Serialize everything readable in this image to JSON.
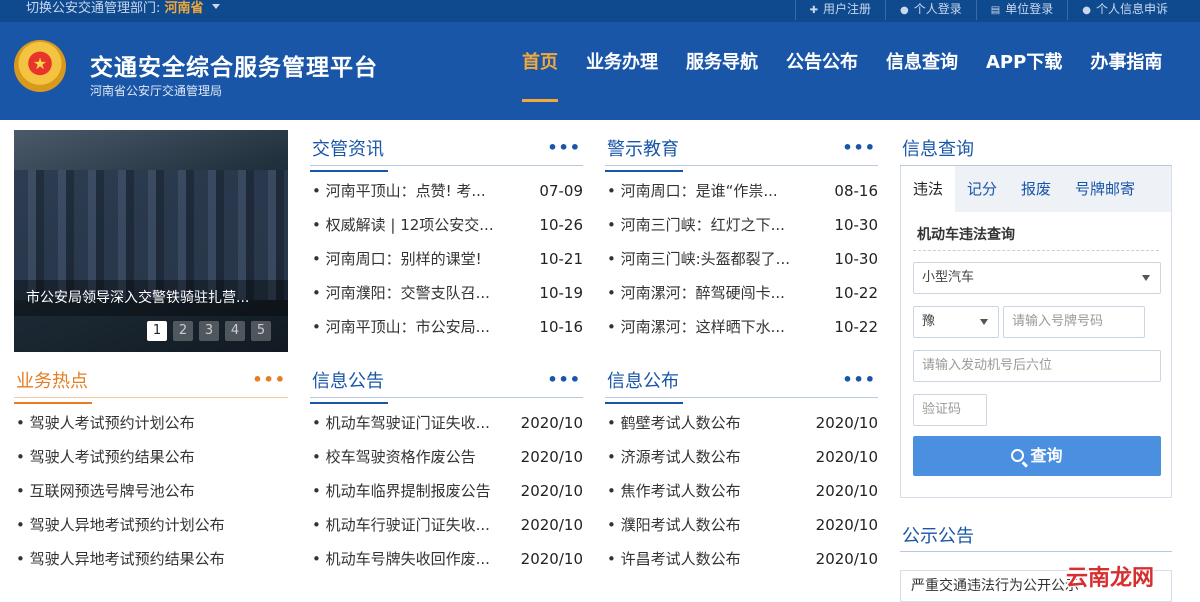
{
  "topbar": {
    "switch_label": "切换公安交通管理部门:",
    "province": "河南省",
    "links": [
      "用户注册",
      "个人登录",
      "单位登录",
      "个人信息申诉"
    ]
  },
  "header": {
    "title": "交通安全综合服务管理平台",
    "subtitle": "河南省公安厅交通管理局",
    "nav": [
      "首页",
      "业务办理",
      "服务导航",
      "公告公布",
      "信息查询",
      "APP下载",
      "办事指南"
    ]
  },
  "carousel": {
    "caption": "市公安局领导深入交警铁骑驻扎营...",
    "dots": [
      "1",
      "2",
      "3",
      "4",
      "5"
    ]
  },
  "panels": {
    "news": {
      "title": "交管资讯",
      "more": "•••",
      "items": [
        {
          "t": "• 河南平顶山：点赞! 考...",
          "d": "07-09"
        },
        {
          "t": "• 权威解读 | 12项公安交...",
          "d": "10-26"
        },
        {
          "t": "• 河南周口：别样的课堂!",
          "d": "10-21"
        },
        {
          "t": "• 河南濮阳：交警支队召...",
          "d": "10-19"
        },
        {
          "t": "• 河南平顶山：市公安局...",
          "d": "10-16"
        }
      ]
    },
    "warning": {
      "title": "警示教育",
      "more": "•••",
      "items": [
        {
          "t": "• 河南周口：是谁“作祟...",
          "d": "08-16"
        },
        {
          "t": "• 河南三门峡：红灯之下...",
          "d": "10-30"
        },
        {
          "t": "• 河南三门峡:头盔都裂了...",
          "d": "10-30"
        },
        {
          "t": "• 河南漯河：醉驾硬闯卡...",
          "d": "10-22"
        },
        {
          "t": "• 河南漯河：这样晒下水...",
          "d": "10-22"
        }
      ]
    },
    "hot": {
      "title": "业务热点",
      "more": "•••",
      "items": [
        {
          "t": "• 驾驶人考试预约计划公布"
        },
        {
          "t": "• 驾驶人考试预约结果公布"
        },
        {
          "t": "• 互联网预选号牌号池公布"
        },
        {
          "t": "• 驾驶人异地考试预约计划公布"
        },
        {
          "t": "• 驾驶人异地考试预约结果公布"
        }
      ]
    },
    "notice": {
      "title": "信息公告",
      "more": "•••",
      "items": [
        {
          "t": "• 机动车驾驶证门证失收...",
          "d": "2020/10"
        },
        {
          "t": "• 校车驾驶资格作废公告",
          "d": "2020/10"
        },
        {
          "t": "• 机动车临界提制报废公告",
          "d": "2020/10"
        },
        {
          "t": "• 机动车行驶证门证失收...",
          "d": "2020/10"
        },
        {
          "t": "• 机动车号牌失收回作废...",
          "d": "2020/10"
        }
      ]
    },
    "publish": {
      "title": "信息公布",
      "more": "•••",
      "items": [
        {
          "t": "• 鹤壁考试人数公布",
          "d": "2020/10"
        },
        {
          "t": "• 济源考试人数公布",
          "d": "2020/10"
        },
        {
          "t": "• 焦作考试人数公布",
          "d": "2020/10"
        },
        {
          "t": "• 濮阳考试人数公布",
          "d": "2020/10"
        },
        {
          "t": "• 许昌考试人数公布",
          "d": "2020/10"
        }
      ]
    }
  },
  "query": {
    "title": "信息查询",
    "tabs": [
      "违法",
      "记分",
      "报废",
      "号牌邮寄"
    ],
    "section": "机动车违法查询",
    "vehicle_type": "小型汽车",
    "province_code": "豫",
    "plate_placeholder": "请输入号牌号码",
    "engine_placeholder": "请输入发动机号后六位",
    "captcha_placeholder": "验证码",
    "submit": "查询"
  },
  "publicity": {
    "title": "公示公告",
    "item": "严重交通违法行为公开公示"
  },
  "watermark": "云南龙网"
}
